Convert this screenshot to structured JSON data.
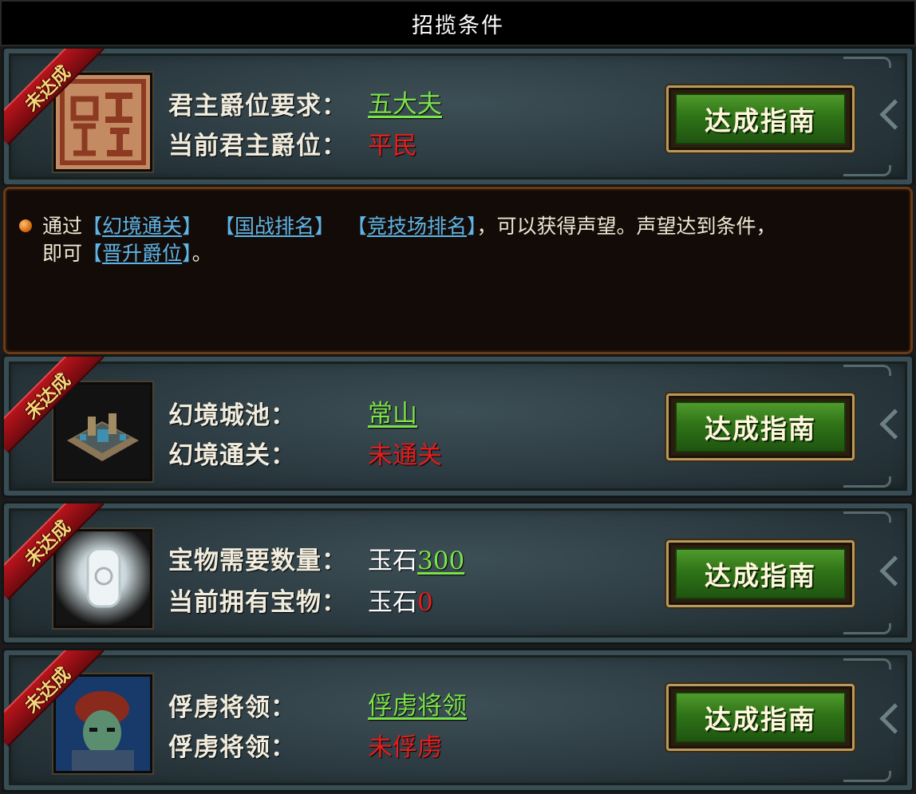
{
  "title": "招揽条件",
  "ribbon_text": "未达成",
  "guide_button_label": "达成指南",
  "cards": [
    {
      "row1_label": "君主爵位要求：",
      "row1_value": "五大夫",
      "row2_label": "当前君主爵位：",
      "row2_value": "平民",
      "icon": "seal-stamp-icon"
    },
    {
      "row1_label": "幻境城池：",
      "row1_value": "常山",
      "row2_label": "幻境通关：",
      "row2_value": "未通关",
      "icon": "fortress-city-icon"
    },
    {
      "row1_label": "宝物需要数量：",
      "row1_prefix": "玉石",
      "row1_value": "300",
      "row2_label": "当前拥有宝物：",
      "row2_prefix": "玉石",
      "row2_value": "0",
      "icon": "jade-stone-icon"
    },
    {
      "row1_label": "俘虏将领：",
      "row1_value": "俘虏将领",
      "row2_label": "俘虏将领：",
      "row2_value": "未俘虏",
      "icon": "general-portrait-icon"
    }
  ],
  "info": {
    "prefix": "通过",
    "link1": "幻境通关",
    "link2": "国战排名",
    "link3": "竞技场排名",
    "middle": "，可以获得声望。声望达到条件，",
    "line2_prefix": "即可",
    "link4": "晋升爵位",
    "suffix": "。",
    "bracket_open": "【",
    "bracket_close": "】"
  },
  "colors": {
    "met_green": "#7be24a",
    "unmet_red": "#e41d1d",
    "link_blue": "#5fb4e6",
    "button_green": "#2f7317"
  }
}
